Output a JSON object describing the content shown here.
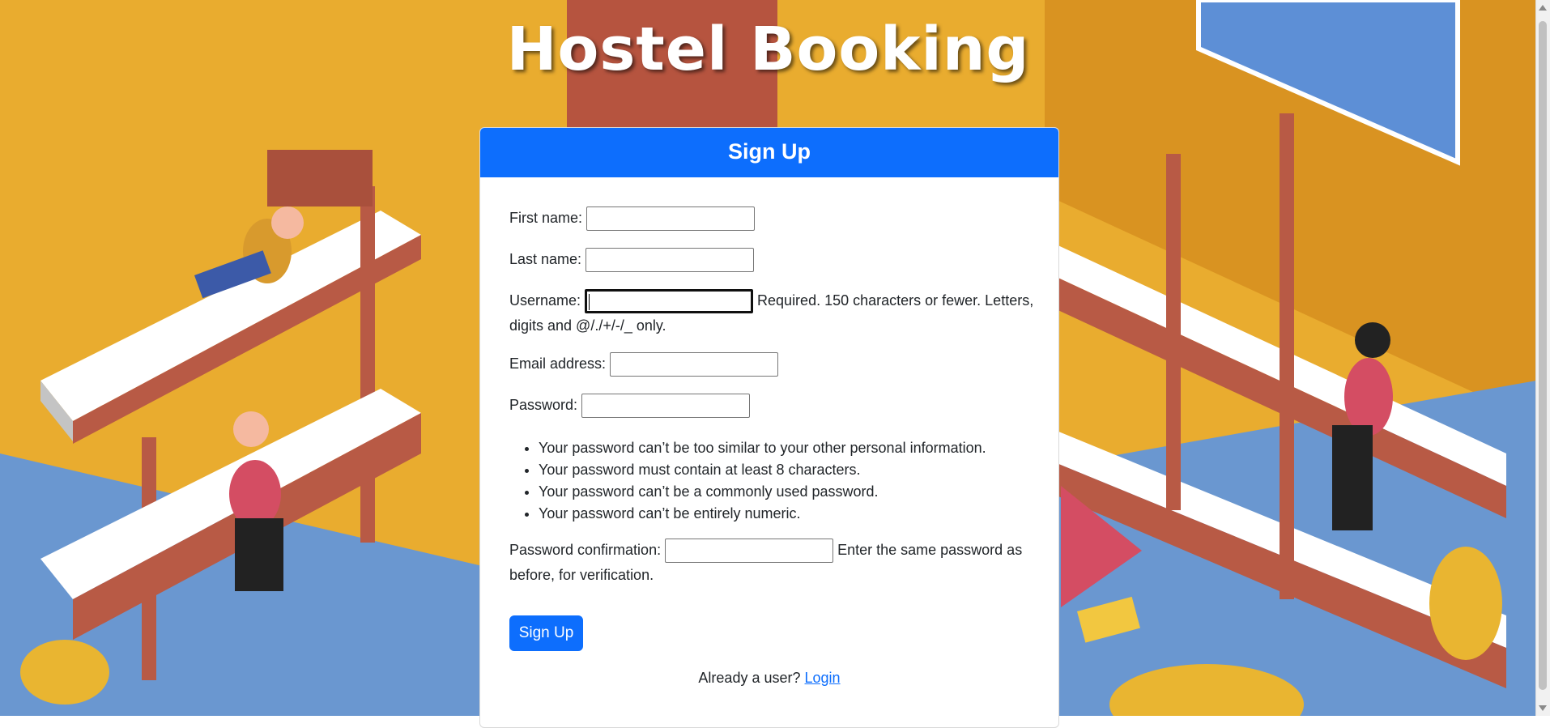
{
  "site_title": "Hostel Booking",
  "card": {
    "title": "Sign Up"
  },
  "form": {
    "first_name": {
      "label": "First name:",
      "value": ""
    },
    "last_name": {
      "label": "Last name:",
      "value": ""
    },
    "username": {
      "label": "Username:",
      "value": "",
      "help_line1": "Required. 150 characters or fewer. Letters,",
      "help_line2": "digits and @/./+/-/_ only."
    },
    "email": {
      "label": "Email address:",
      "value": ""
    },
    "password": {
      "label": "Password:",
      "value": "",
      "rules": [
        "Your password can’t be too similar to your other personal information.",
        "Your password must contain at least 8 characters.",
        "Your password can’t be a commonly used password.",
        "Your password can’t be entirely numeric."
      ]
    },
    "password_confirmation": {
      "label": "Password confirmation:",
      "value": "",
      "help_line1": "Enter the same password as",
      "help_line2": "before, for verification."
    },
    "submit_label": "Sign Up"
  },
  "footer": {
    "prompt": "Already a user?",
    "login_link": "Login"
  },
  "colors": {
    "primary": "#0d6efd",
    "wall": "#e9ac2f",
    "floor": "#6a97d0",
    "bed_wood": "#b85a45",
    "mattress": "#ffffff"
  }
}
